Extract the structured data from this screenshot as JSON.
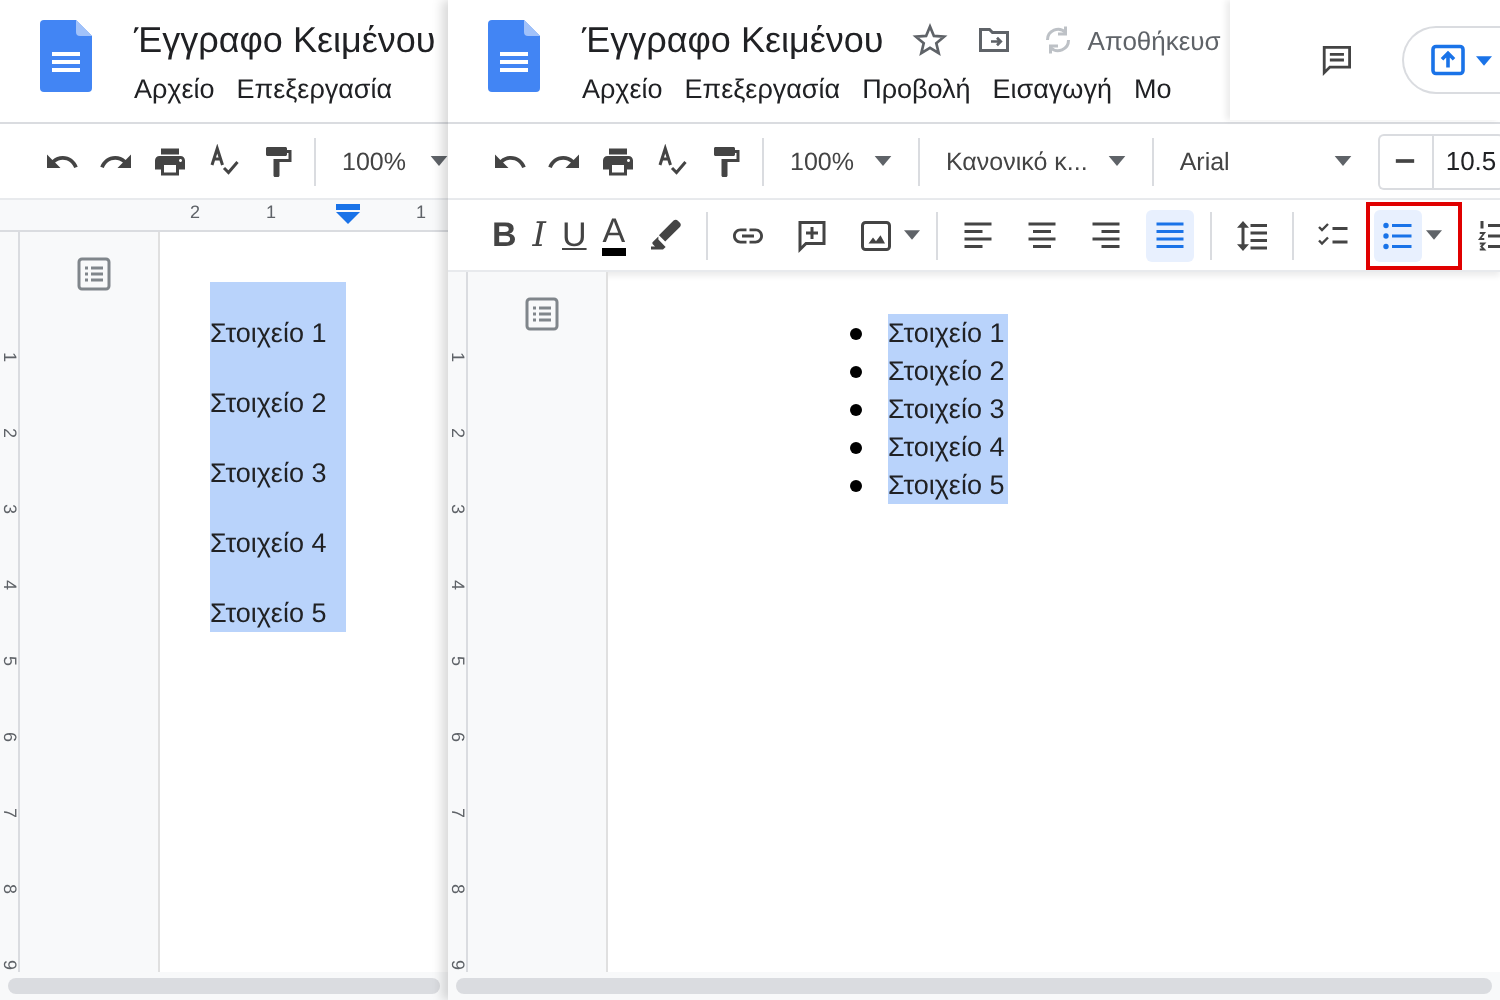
{
  "windows": [
    {
      "title": "Έγγραφο Κειμένου",
      "menu": [
        "Αρχείο",
        "Επεξεργασία"
      ],
      "toolbar": [
        {
          "kind": "undo"
        },
        {
          "kind": "redo"
        },
        {
          "kind": "print"
        },
        {
          "kind": "spellcheck"
        },
        {
          "kind": "paint"
        },
        {
          "kind": "sep"
        },
        {
          "kind": "dropdown",
          "label": "100%"
        }
      ],
      "ruler": [
        "2",
        "1",
        "1"
      ],
      "vertical_ruler": [
        "1",
        "2",
        "3",
        "4",
        "5",
        "6",
        "7",
        "8",
        "9"
      ],
      "bulleted": false,
      "items": [
        "Στοιχείο 1",
        "Στοιχείο 2",
        "Στοιχείο 3",
        "Στοιχείο 4",
        "Στοιχείο 5"
      ]
    },
    {
      "title": "Έγγραφο Κειμένου",
      "save_status": "Αποθήκευσ",
      "share": true,
      "menu": [
        "Αρχείο",
        "Επεξεργασία",
        "Προβολή",
        "Εισαγωγή",
        "Μο"
      ],
      "toolbar": [
        {
          "kind": "undo"
        },
        {
          "kind": "redo"
        },
        {
          "kind": "print"
        },
        {
          "kind": "spellcheck"
        },
        {
          "kind": "paint"
        },
        {
          "kind": "sep"
        },
        {
          "kind": "dropdown",
          "label": "100%"
        },
        {
          "kind": "sep"
        },
        {
          "kind": "dropdown",
          "label": "Κανονικό κ..."
        },
        {
          "kind": "sep"
        },
        {
          "kind": "dropdown",
          "label": "Arial",
          "wide": true
        },
        {
          "kind": "stepper",
          "label": "10.5"
        }
      ],
      "format_toolbar": [
        {
          "kind": "bold",
          "label": "B"
        },
        {
          "kind": "italic",
          "label": "I"
        },
        {
          "kind": "underline",
          "label": "U"
        },
        {
          "kind": "color",
          "label": "A"
        },
        {
          "kind": "highlighter"
        },
        {
          "kind": "sep"
        },
        {
          "kind": "link"
        },
        {
          "kind": "comment"
        },
        {
          "kind": "image",
          "caret": true
        },
        {
          "kind": "sep"
        },
        {
          "kind": "align-left",
          "selected": false
        },
        {
          "kind": "align-center",
          "selected": false
        },
        {
          "kind": "align-right",
          "selected": false
        },
        {
          "kind": "align-justify",
          "selected": true
        },
        {
          "kind": "sep"
        },
        {
          "kind": "line-spacing"
        },
        {
          "kind": "sep"
        },
        {
          "kind": "checklist",
          "selected": false
        },
        {
          "kind": "bullets",
          "selected": true,
          "caret": true,
          "highlighted": true
        },
        {
          "kind": "numbered",
          "selected": false
        }
      ],
      "vertical_ruler": [
        "1",
        "2",
        "3",
        "4",
        "5",
        "6",
        "7",
        "8",
        "9"
      ],
      "bulleted": true,
      "items": [
        "Στοιχείο 1",
        "Στοιχείο 2",
        "Στοιχείο 3",
        "Στοιχείο 4",
        "Στοιχείο 5"
      ]
    }
  ]
}
